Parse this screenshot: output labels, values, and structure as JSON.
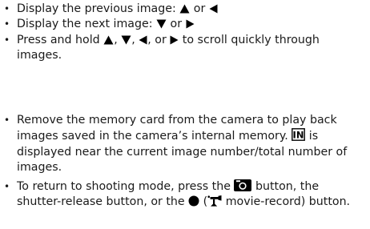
{
  "navigation_items": [
    {
      "text_before": "Display the previous image: ",
      "icon_1": "up-arrow-icon",
      "text_mid": " or ",
      "icon_2": "left-arrow-icon"
    },
    {
      "text_before": "Display the next image: ",
      "icon_1": "down-arrow-icon",
      "text_mid": " or ",
      "icon_2": "right-arrow-icon"
    },
    {
      "text_before": "Press and hold ",
      "sep_1": ", ",
      "sep_2": ", ",
      "sep_3": ", or ",
      "text_after": " to scroll quickly through images.",
      "icons": [
        "up-arrow-icon",
        "down-arrow-icon",
        "left-arrow-icon",
        "right-arrow-icon"
      ]
    }
  ],
  "notes": [
    {
      "text_before": "Remove the memory card from the camera to play back images saved in the camera’s internal memory. ",
      "icon": "internal-memory-icon",
      "icon_label": "IN",
      "text_after": " is displayed near the current image number/total number of images."
    },
    {
      "text_before": "To return to shooting mode, press the ",
      "icon_camera": "camera-button-icon",
      "text_mid_1": " button, the shutter-release button, or the ",
      "icon_record": "record-dot-icon",
      "text_mid_2": " (",
      "icon_movie": "movie-camera-icon",
      "text_after": " movie-record) button."
    }
  ],
  "colors": {
    "text": "#1a1a1a",
    "icon": "#000000"
  }
}
